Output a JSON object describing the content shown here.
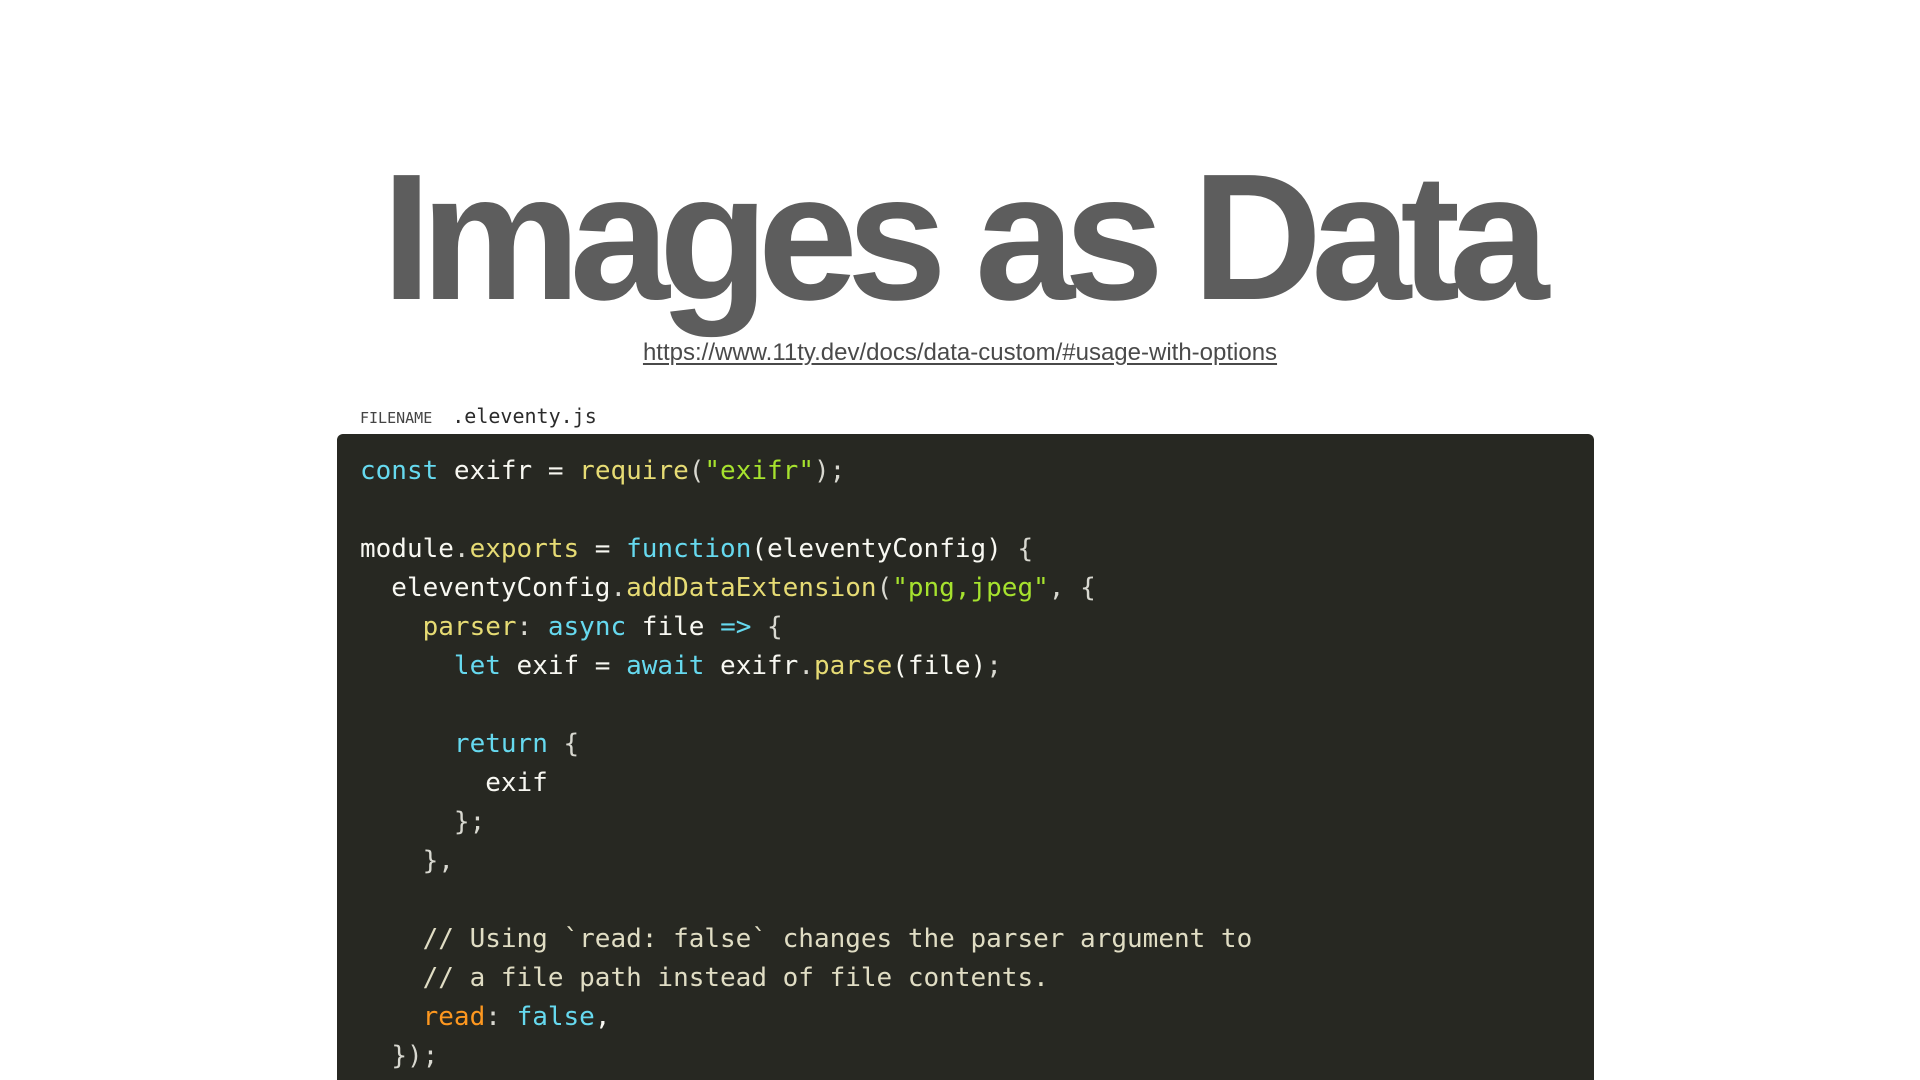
{
  "title": "Images as Data",
  "link": {
    "text": "https://www.11ty.dev/docs/data-custom/#usage-with-options"
  },
  "code_block": {
    "filename_label": "FILENAME",
    "filename": ".eleventy.js",
    "lines": [
      [
        {
          "t": "const",
          "c": "kw"
        },
        {
          "t": " exifr = ",
          "c": "plain"
        },
        {
          "t": "require",
          "c": "fn"
        },
        {
          "t": "(",
          "c": "punc"
        },
        {
          "t": "\"exifr\"",
          "c": "str"
        },
        {
          "t": ");",
          "c": "punc"
        }
      ],
      [],
      [
        {
          "t": "module",
          "c": "plain"
        },
        {
          "t": ".",
          "c": "punc"
        },
        {
          "t": "exports",
          "c": "fn"
        },
        {
          "t": " = ",
          "c": "plain"
        },
        {
          "t": "function",
          "c": "kw"
        },
        {
          "t": "(eleventyConfig)",
          "c": "plain"
        },
        {
          "t": " {",
          "c": "punc"
        }
      ],
      [
        {
          "t": "  eleventyConfig",
          "c": "plain"
        },
        {
          "t": ".",
          "c": "punc"
        },
        {
          "t": "addDataExtension",
          "c": "fn"
        },
        {
          "t": "(",
          "c": "punc"
        },
        {
          "t": "\"png,jpeg\"",
          "c": "str"
        },
        {
          "t": ", {",
          "c": "punc"
        }
      ],
      [
        {
          "t": "    ",
          "c": "plain"
        },
        {
          "t": "parser",
          "c": "fn"
        },
        {
          "t": ": ",
          "c": "punc"
        },
        {
          "t": "async",
          "c": "kw"
        },
        {
          "t": " file ",
          "c": "plain"
        },
        {
          "t": "=>",
          "c": "kw"
        },
        {
          "t": " {",
          "c": "punc"
        }
      ],
      [
        {
          "t": "      ",
          "c": "plain"
        },
        {
          "t": "let",
          "c": "kw"
        },
        {
          "t": " exif = ",
          "c": "plain"
        },
        {
          "t": "await",
          "c": "kw"
        },
        {
          "t": " exifr",
          "c": "plain"
        },
        {
          "t": ".",
          "c": "punc"
        },
        {
          "t": "parse",
          "c": "fn"
        },
        {
          "t": "(file)",
          "c": "plain"
        },
        {
          "t": ";",
          "c": "punc"
        }
      ],
      [],
      [
        {
          "t": "      ",
          "c": "plain"
        },
        {
          "t": "return",
          "c": "kw"
        },
        {
          "t": " {",
          "c": "punc"
        }
      ],
      [
        {
          "t": "        exif",
          "c": "plain"
        }
      ],
      [
        {
          "t": "      ",
          "c": "plain"
        },
        {
          "t": "};",
          "c": "punc"
        }
      ],
      [
        {
          "t": "    ",
          "c": "plain"
        },
        {
          "t": "},",
          "c": "punc"
        }
      ],
      [],
      [
        {
          "t": "    // Using `read: false` changes the parser argument to",
          "c": "cm"
        }
      ],
      [
        {
          "t": "    // a file path instead of file contents.",
          "c": "cm"
        }
      ],
      [
        {
          "t": "    ",
          "c": "plain"
        },
        {
          "t": "read",
          "c": "prop"
        },
        {
          "t": ": ",
          "c": "punc"
        },
        {
          "t": "false",
          "c": "kw"
        },
        {
          "t": ",",
          "c": "plain"
        }
      ],
      [
        {
          "t": "  ",
          "c": "plain"
        },
        {
          "t": "});",
          "c": "punc"
        }
      ]
    ]
  },
  "colors": {
    "title": "#5d5d5d",
    "code_background": "#272822",
    "keyword": "#66d9ef",
    "function": "#e6db74",
    "string": "#a6e22e",
    "property": "#fd971f",
    "comment": "#e0ddc4"
  }
}
